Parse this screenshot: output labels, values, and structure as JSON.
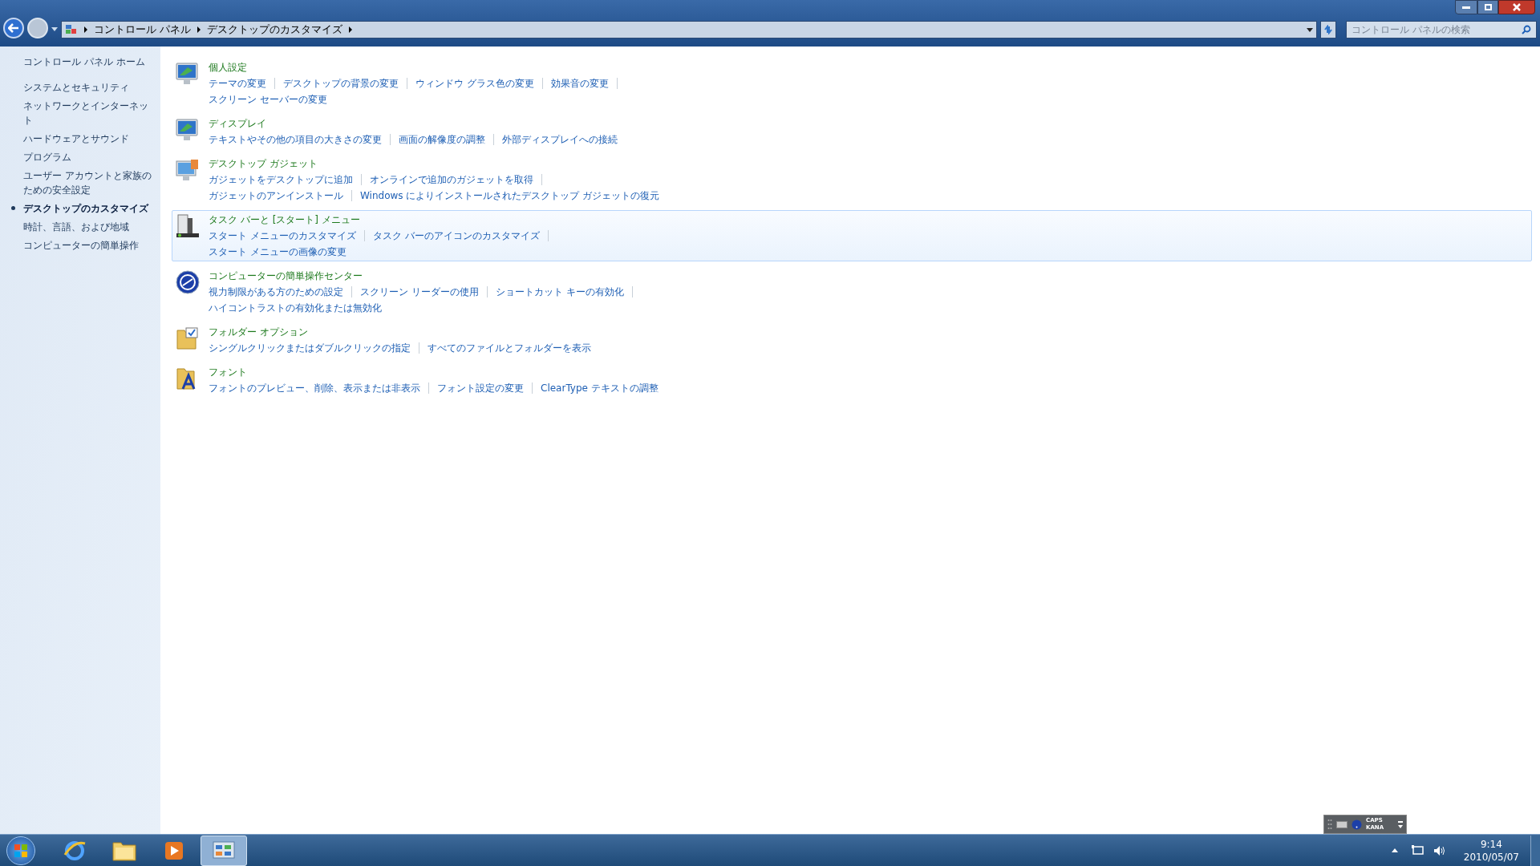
{
  "window": {
    "breadcrumb": [
      "コントロール パネル",
      "デスクトップのカスタマイズ"
    ],
    "search": {
      "placeholder": "コントロール パネルの検索"
    }
  },
  "sidebar": {
    "items": [
      {
        "label": "コントロール パネル ホーム",
        "selected": false,
        "kind": "home"
      },
      {
        "label": "システムとセキュリティ",
        "selected": false,
        "kind": "link"
      },
      {
        "label": "ネットワークとインターネット",
        "selected": false,
        "kind": "link"
      },
      {
        "label": "ハードウェアとサウンド",
        "selected": false,
        "kind": "link"
      },
      {
        "label": "プログラム",
        "selected": false,
        "kind": "link"
      },
      {
        "label": "ユーザー アカウントと家族のための安全設定",
        "selected": false,
        "kind": "link"
      },
      {
        "label": "デスクトップのカスタマイズ",
        "selected": true,
        "kind": "link"
      },
      {
        "label": "時計、言語、および地域",
        "selected": false,
        "kind": "link"
      },
      {
        "label": "コンピューターの簡単操作",
        "selected": false,
        "kind": "link"
      }
    ]
  },
  "categories": [
    {
      "title": "個人設定",
      "kind": "monitor",
      "highlighted": false,
      "rows": [
        [
          "テーマの変更",
          "デスクトップの背景の変更",
          "ウィンドウ グラス色の変更",
          "効果音の変更"
        ],
        [
          "スクリーン セーバーの変更"
        ]
      ]
    },
    {
      "title": "ディスプレイ",
      "kind": "monitor",
      "highlighted": false,
      "rows": [
        [
          "テキストやその他の項目の大きさの変更",
          "画面の解像度の調整",
          "外部ディスプレイへの接続"
        ]
      ]
    },
    {
      "title": "デスクトップ ガジェット",
      "kind": "gadget",
      "highlighted": false,
      "rows": [
        [
          "ガジェットをデスクトップに追加",
          "オンラインで追加のガジェットを取得"
        ],
        [
          "ガジェットのアンインストール",
          "Windows によりインストールされたデスクトップ ガジェットの復元"
        ]
      ]
    },
    {
      "title": "タスク バーと [スタート] メニュー",
      "kind": "taskbar",
      "highlighted": true,
      "rows": [
        [
          "スタート メニューのカスタマイズ",
          "タスク バーのアイコンのカスタマイズ"
        ],
        [
          "スタート メニューの画像の変更"
        ]
      ]
    },
    {
      "title": "コンピューターの簡単操作センター",
      "kind": "access",
      "highlighted": false,
      "rows": [
        [
          "視力制限がある方のための設定",
          "スクリーン リーダーの使用",
          "ショートカット キーの有効化"
        ],
        [
          "ハイコントラストの有効化または無効化"
        ]
      ]
    },
    {
      "title": "フォルダー オプション",
      "kind": "folder",
      "highlighted": false,
      "rows": [
        [
          "シングルクリックまたはダブルクリックの指定",
          "すべてのファイルとフォルダーを表示"
        ]
      ]
    },
    {
      "title": "フォント",
      "kind": "font",
      "highlighted": false,
      "rows": [
        [
          "フォントのプレビュー、削除、表示または非表示",
          "フォント設定の変更",
          "ClearType テキストの調整"
        ]
      ]
    }
  ],
  "language_bar": {
    "caps": "CAPS",
    "kana": "KANA"
  },
  "taskbar": {
    "buttons": [
      {
        "kind": "browser",
        "selected": false
      },
      {
        "kind": "folder",
        "selected": false
      },
      {
        "kind": "media",
        "selected": false
      },
      {
        "kind": "control-panel",
        "selected": true
      }
    ],
    "clock": {
      "time": "9:14",
      "date": "2010/05/07"
    }
  }
}
